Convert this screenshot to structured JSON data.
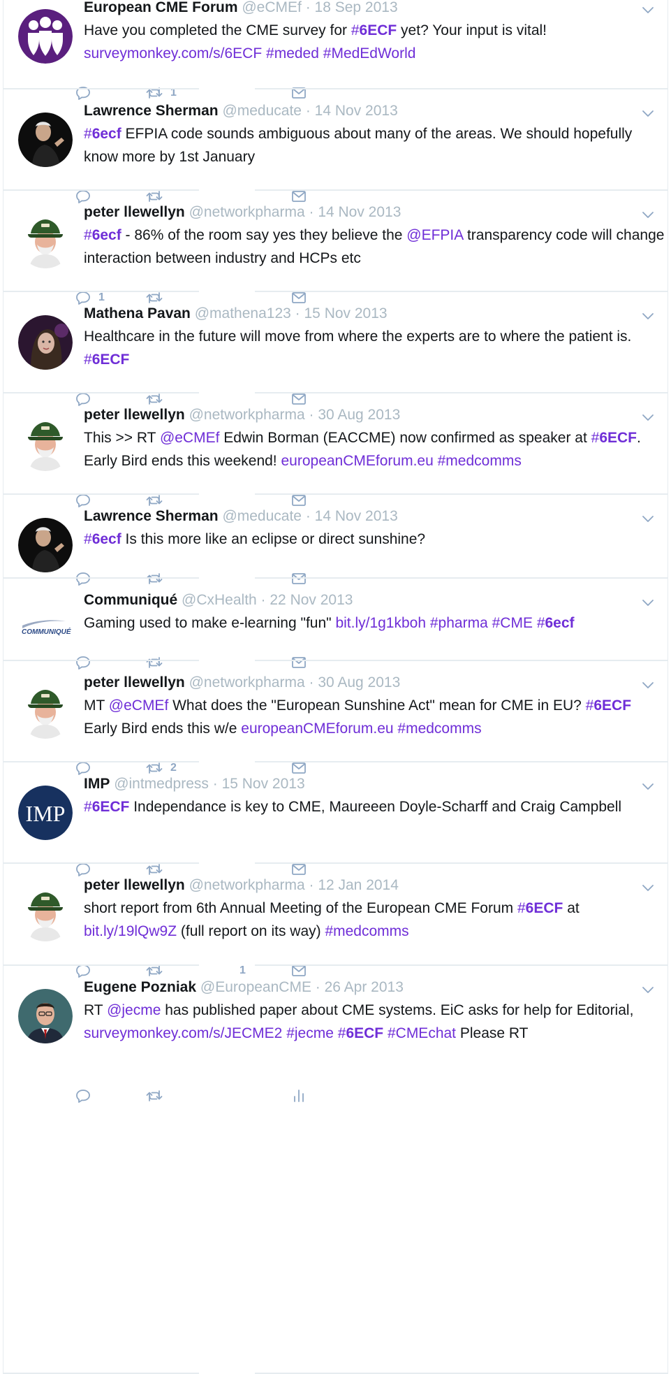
{
  "tweets": [
    {
      "name": "European CME Forum",
      "handle": "@eCMEf",
      "date": "18 Sep 2013",
      "avatar": "ecmef-logo",
      "segments": [
        {
          "t": "Have you completed the CME survey for ",
          "k": "text"
        },
        {
          "t": "#",
          "k": "hash-pre"
        },
        {
          "t": "6ECF",
          "k": "hash-bold"
        },
        {
          "t": " yet? Your input is vital!\n",
          "k": "text"
        },
        {
          "t": "surveymonkey.com/s/6ECF",
          "k": "link"
        },
        {
          "t": " ",
          "k": "text"
        },
        {
          "t": "#meded",
          "k": "link"
        },
        {
          "t": " ",
          "k": "text"
        },
        {
          "t": "#MedEdWorld",
          "k": "link"
        }
      ],
      "replies": "",
      "retweets": "1",
      "likes": "",
      "third": "mail"
    },
    {
      "name": "Lawrence Sherman",
      "handle": "@meducate",
      "date": "14 Nov 2013",
      "avatar": "sherman",
      "segments": [
        {
          "t": "#",
          "k": "hash-pre"
        },
        {
          "t": "6ecf",
          "k": "hash-bold"
        },
        {
          "t": " EFPIA code sounds ambiguous about many of the areas. We should hopefully know more by 1st January",
          "k": "text"
        }
      ],
      "replies": "",
      "retweets": "",
      "likes": "",
      "third": "mail"
    },
    {
      "name": "peter llewellyn",
      "handle": "@networkpharma",
      "date": "14 Nov 2013",
      "avatar": "llewellyn",
      "segments": [
        {
          "t": "#",
          "k": "hash-pre"
        },
        {
          "t": "6ecf",
          "k": "hash-bold"
        },
        {
          "t": " - 86% of the room say yes they believe the ",
          "k": "text"
        },
        {
          "t": "@EFPIA",
          "k": "link"
        },
        {
          "t": " transparency code will change interaction between industry and HCPs etc",
          "k": "text"
        }
      ],
      "replies": "1",
      "retweets": "",
      "likes": "",
      "third": "mail"
    },
    {
      "name": "Mathena Pavan",
      "handle": "@mathena123",
      "date": "15 Nov 2013",
      "avatar": "pavan",
      "segments": [
        {
          "t": "Healthcare in the future will move from where the experts are to where the patient is. ",
          "k": "text"
        },
        {
          "t": "#",
          "k": "hash-pre"
        },
        {
          "t": "6ECF",
          "k": "hash-bold"
        }
      ],
      "replies": "",
      "retweets": "",
      "likes": "",
      "third": "mail"
    },
    {
      "name": "peter llewellyn",
      "handle": "@networkpharma",
      "date": "30 Aug 2013",
      "avatar": "llewellyn",
      "segments": [
        {
          "t": "This  >> RT ",
          "k": "text"
        },
        {
          "t": "@eCMEf",
          "k": "link"
        },
        {
          "t": " Edwin Borman (EACCME) now confirmed as speaker at ",
          "k": "text"
        },
        {
          "t": "#",
          "k": "hash-pre"
        },
        {
          "t": "6ECF",
          "k": "hash-bold"
        },
        {
          "t": ". Early Bird ends this weekend! ",
          "k": "text"
        },
        {
          "t": "europeanCMEforum.eu",
          "k": "link"
        },
        {
          "t": "  ",
          "k": "text"
        },
        {
          "t": "#medcomms",
          "k": "link"
        }
      ],
      "replies": "",
      "retweets": "",
      "likes": "",
      "third": "mail"
    },
    {
      "name": "Lawrence Sherman",
      "handle": "@meducate",
      "date": "14 Nov 2013",
      "avatar": "sherman",
      "segments": [
        {
          "t": "#",
          "k": "hash-pre"
        },
        {
          "t": "6ecf",
          "k": "hash-bold"
        },
        {
          "t": " Is this more like an eclipse or direct sunshine?",
          "k": "text"
        }
      ],
      "replies": "",
      "retweets": "",
      "likes": "",
      "third": "mail"
    },
    {
      "name": "Communiqué",
      "handle": "@CxHealth",
      "date": "22 Nov 2013",
      "avatar": "communique",
      "segments": [
        {
          "t": "Gaming used to make e-learning \"fun\" ",
          "k": "text"
        },
        {
          "t": "bit.ly/1g1kboh",
          "k": "link"
        },
        {
          "t": " ",
          "k": "text"
        },
        {
          "t": "#pharma",
          "k": "link"
        },
        {
          "t": " ",
          "k": "text"
        },
        {
          "t": "#CME",
          "k": "link"
        },
        {
          "t": " ",
          "k": "text"
        },
        {
          "t": "#",
          "k": "hash-pre"
        },
        {
          "t": "6ecf",
          "k": "hash-bold"
        }
      ],
      "replies": "",
      "retweets": "",
      "likes": "",
      "third": "mail"
    },
    {
      "name": "peter llewellyn",
      "handle": "@networkpharma",
      "date": "30 Aug 2013",
      "avatar": "llewellyn",
      "segments": [
        {
          "t": "MT  ",
          "k": "text"
        },
        {
          "t": "@eCMEf",
          "k": "link"
        },
        {
          "t": " What does the \"European Sunshine Act\" mean for CME in EU? ",
          "k": "text"
        },
        {
          "t": "#",
          "k": "hash-pre"
        },
        {
          "t": "6ECF",
          "k": "hash-bold"
        },
        {
          "t": " Early Bird ends this w/e ",
          "k": "text"
        },
        {
          "t": "europeanCMEforum.eu",
          "k": "link"
        },
        {
          "t": " ",
          "k": "text"
        },
        {
          "t": "#medcomms",
          "k": "link"
        }
      ],
      "replies": "",
      "retweets": "2",
      "likes": "",
      "third": "mail"
    },
    {
      "name": "IMP",
      "handle": "@intmedpress",
      "date": "15 Nov 2013",
      "avatar": "imp",
      "segments": [
        {
          "t": "#",
          "k": "hash-pre"
        },
        {
          "t": "6ECF",
          "k": "hash-bold"
        },
        {
          "t": " Independance is key to CME, Maureeen Doyle-Scharff and Craig Campbell",
          "k": "text"
        }
      ],
      "replies": "",
      "retweets": "",
      "likes": "",
      "third": "mail"
    },
    {
      "name": "peter llewellyn",
      "handle": "@networkpharma",
      "date": "12 Jan 2014",
      "avatar": "llewellyn",
      "segments": [
        {
          "t": "short report from 6th Annual Meeting of the European CME Forum ",
          "k": "text"
        },
        {
          "t": "#",
          "k": "hash-pre"
        },
        {
          "t": "6ECF",
          "k": "hash-bold"
        },
        {
          "t": " at ",
          "k": "text"
        },
        {
          "t": "bit.ly/19lQw9Z",
          "k": "link"
        },
        {
          "t": " (full report on its way) ",
          "k": "text"
        },
        {
          "t": "#medcomms",
          "k": "link"
        }
      ],
      "replies": "",
      "retweets": "",
      "likes": "1",
      "third": "mail"
    },
    {
      "name": "Eugene Pozniak",
      "handle": "@EuropeanCME",
      "date": "26 Apr 2013",
      "avatar": "pozniak",
      "segments": [
        {
          "t": "RT ",
          "k": "text"
        },
        {
          "t": "@jecme",
          "k": "link"
        },
        {
          "t": " has published paper about CME systems. EiC asks for help for Editorial,\n",
          "k": "text"
        },
        {
          "t": "surveymonkey.com/s/JECME2",
          "k": "link"
        },
        {
          "t": " ",
          "k": "text"
        },
        {
          "t": "#jecme",
          "k": "link"
        },
        {
          "t": " ",
          "k": "text"
        },
        {
          "t": "#",
          "k": "hash-pre"
        },
        {
          "t": "6ECF",
          "k": "hash-bold"
        },
        {
          "t": " ",
          "k": "text"
        },
        {
          "t": "#CMEchat",
          "k": "link"
        },
        {
          "t": " Please RT",
          "k": "text"
        }
      ],
      "replies": "",
      "retweets": "",
      "likes": "",
      "third": "analytics"
    }
  ],
  "colors": {
    "link": "#6f2ed7",
    "meta": "#aab8c2",
    "icon": "#8fa7c4",
    "divider": "#e6ecf0"
  },
  "icons": [
    "reply-icon",
    "retweet-icon",
    "like-icon",
    "mail-icon",
    "analytics-icon",
    "chevron-down-icon"
  ]
}
